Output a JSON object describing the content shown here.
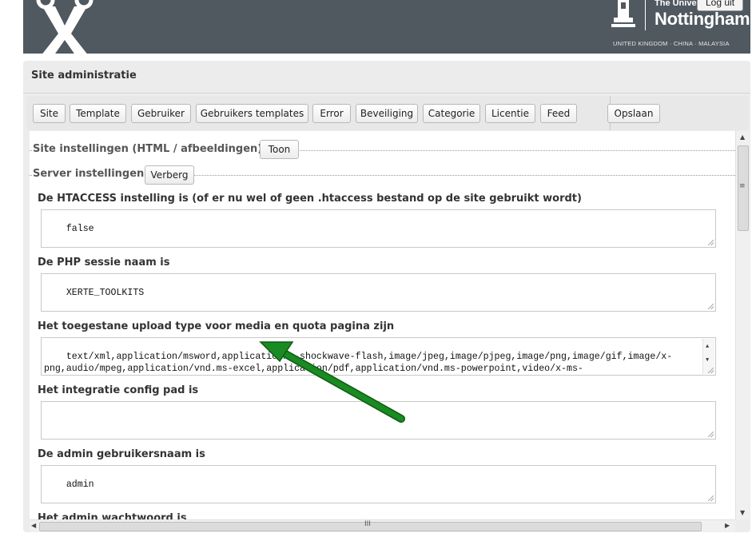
{
  "header": {
    "uni_small": "The Unive",
    "uni_name": "Nottingham",
    "uni_tagline": "UNITED KINGDOM · CHINA · MALAYSIA",
    "logout_label": "Log uit"
  },
  "panel": {
    "title": "Site administratie"
  },
  "tabs": [
    {
      "label": "Site"
    },
    {
      "label": "Template"
    },
    {
      "label": "Gebruiker"
    },
    {
      "label": "Gebruikers templates"
    },
    {
      "label": "Error"
    },
    {
      "label": "Beveiliging"
    },
    {
      "label": "Categorie"
    },
    {
      "label": "Licentie"
    },
    {
      "label": "Feed"
    }
  ],
  "save_label": "Opslaan",
  "sections": {
    "site_settings": {
      "legend": "Site instellingen (HTML / afbeeldingen)",
      "toggle": "Toon"
    },
    "server_settings": {
      "legend": "Server instellingen",
      "toggle": "Verberg"
    }
  },
  "fields": [
    {
      "label": "De HTACCESS instelling is (of er nu wel of geen .htaccess bestand op de site gebruikt wordt)",
      "value": "false"
    },
    {
      "label": "De PHP sessie naam is",
      "value": "XERTE_TOOLKITS"
    },
    {
      "label": "Het toegestane upload type voor media en quota pagina zijn",
      "value": "text/xml,application/msword,application/x-shockwave-flash,image/jpeg,image/pjpeg,image/png,image/gif,image/x-png,audio/mpeg,application/vnd.ms-excel,application/pdf,application/vnd.ms-powerpoint,video/x-ms-wmv,text/html,video/mp4,video/avi,audio/wav,text/plain,video"
    },
    {
      "label": "Het integratie config pad is",
      "value": ""
    },
    {
      "label": "De admin gebruikersnaam is",
      "value": "admin"
    },
    {
      "label": "Het admin wachtwoord is",
      "value": ""
    }
  ],
  "scrollbar": {
    "h_middle": "III",
    "v_middle": "≡"
  },
  "colors": {
    "header_bg": "#505860",
    "annotation_arrow": "#1a8a22"
  }
}
